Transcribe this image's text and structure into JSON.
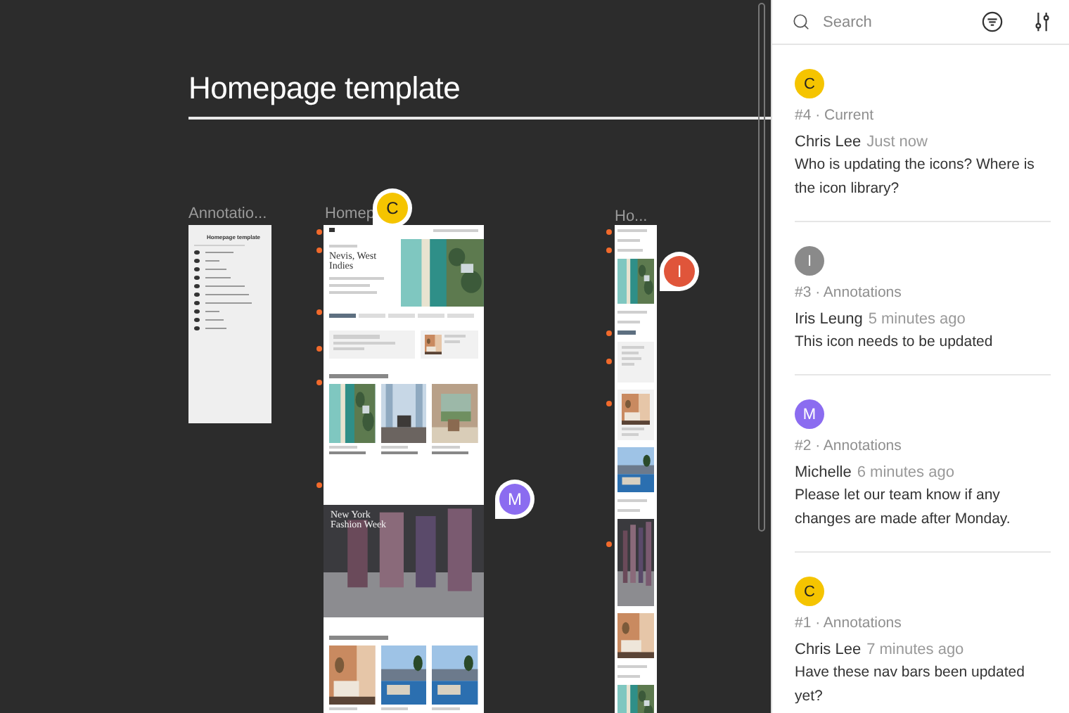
{
  "canvas": {
    "title": "Homepage template",
    "frames": [
      {
        "kind": "annotations",
        "label": "Annotatio...",
        "heading": "Homepage template"
      },
      {
        "kind": "desktop",
        "label": "Homep",
        "hero_title": "Nevis, West Indies",
        "feature_title": "New York Fashion Week"
      },
      {
        "kind": "mobile",
        "label": "Ho..."
      }
    ],
    "pins": [
      {
        "initial": "C",
        "color": "#f5c400"
      },
      {
        "initial": "I",
        "color": "#e0553a"
      },
      {
        "initial": "M",
        "color": "#8b6cf0"
      }
    ]
  },
  "panel": {
    "search": {
      "placeholder": "Search"
    },
    "comments": [
      {
        "initial": "C",
        "color": "#f5c400",
        "tag": "#4 · Current",
        "author": "Chris Lee",
        "time": "Just now",
        "text": "Who is updating the icons? Where is the icon library?"
      },
      {
        "initial": "I",
        "color": "#8a8a8a",
        "tag": "#3 · Annotations",
        "author": "Iris Leung",
        "time": "5 minutes ago",
        "text": "This icon needs to be updated"
      },
      {
        "initial": "M",
        "color": "#8b6cf0",
        "tag": "#2 · Annotations",
        "author": "Michelle",
        "time": "6 minutes ago",
        "text": "Please let our team know if any changes are made after Monday."
      },
      {
        "initial": "C",
        "color": "#f5c400",
        "tag": "#1 · Annotations",
        "author": "Chris Lee",
        "time": "7 minutes ago",
        "text": "Have these nav bars been updated yet?"
      }
    ]
  }
}
